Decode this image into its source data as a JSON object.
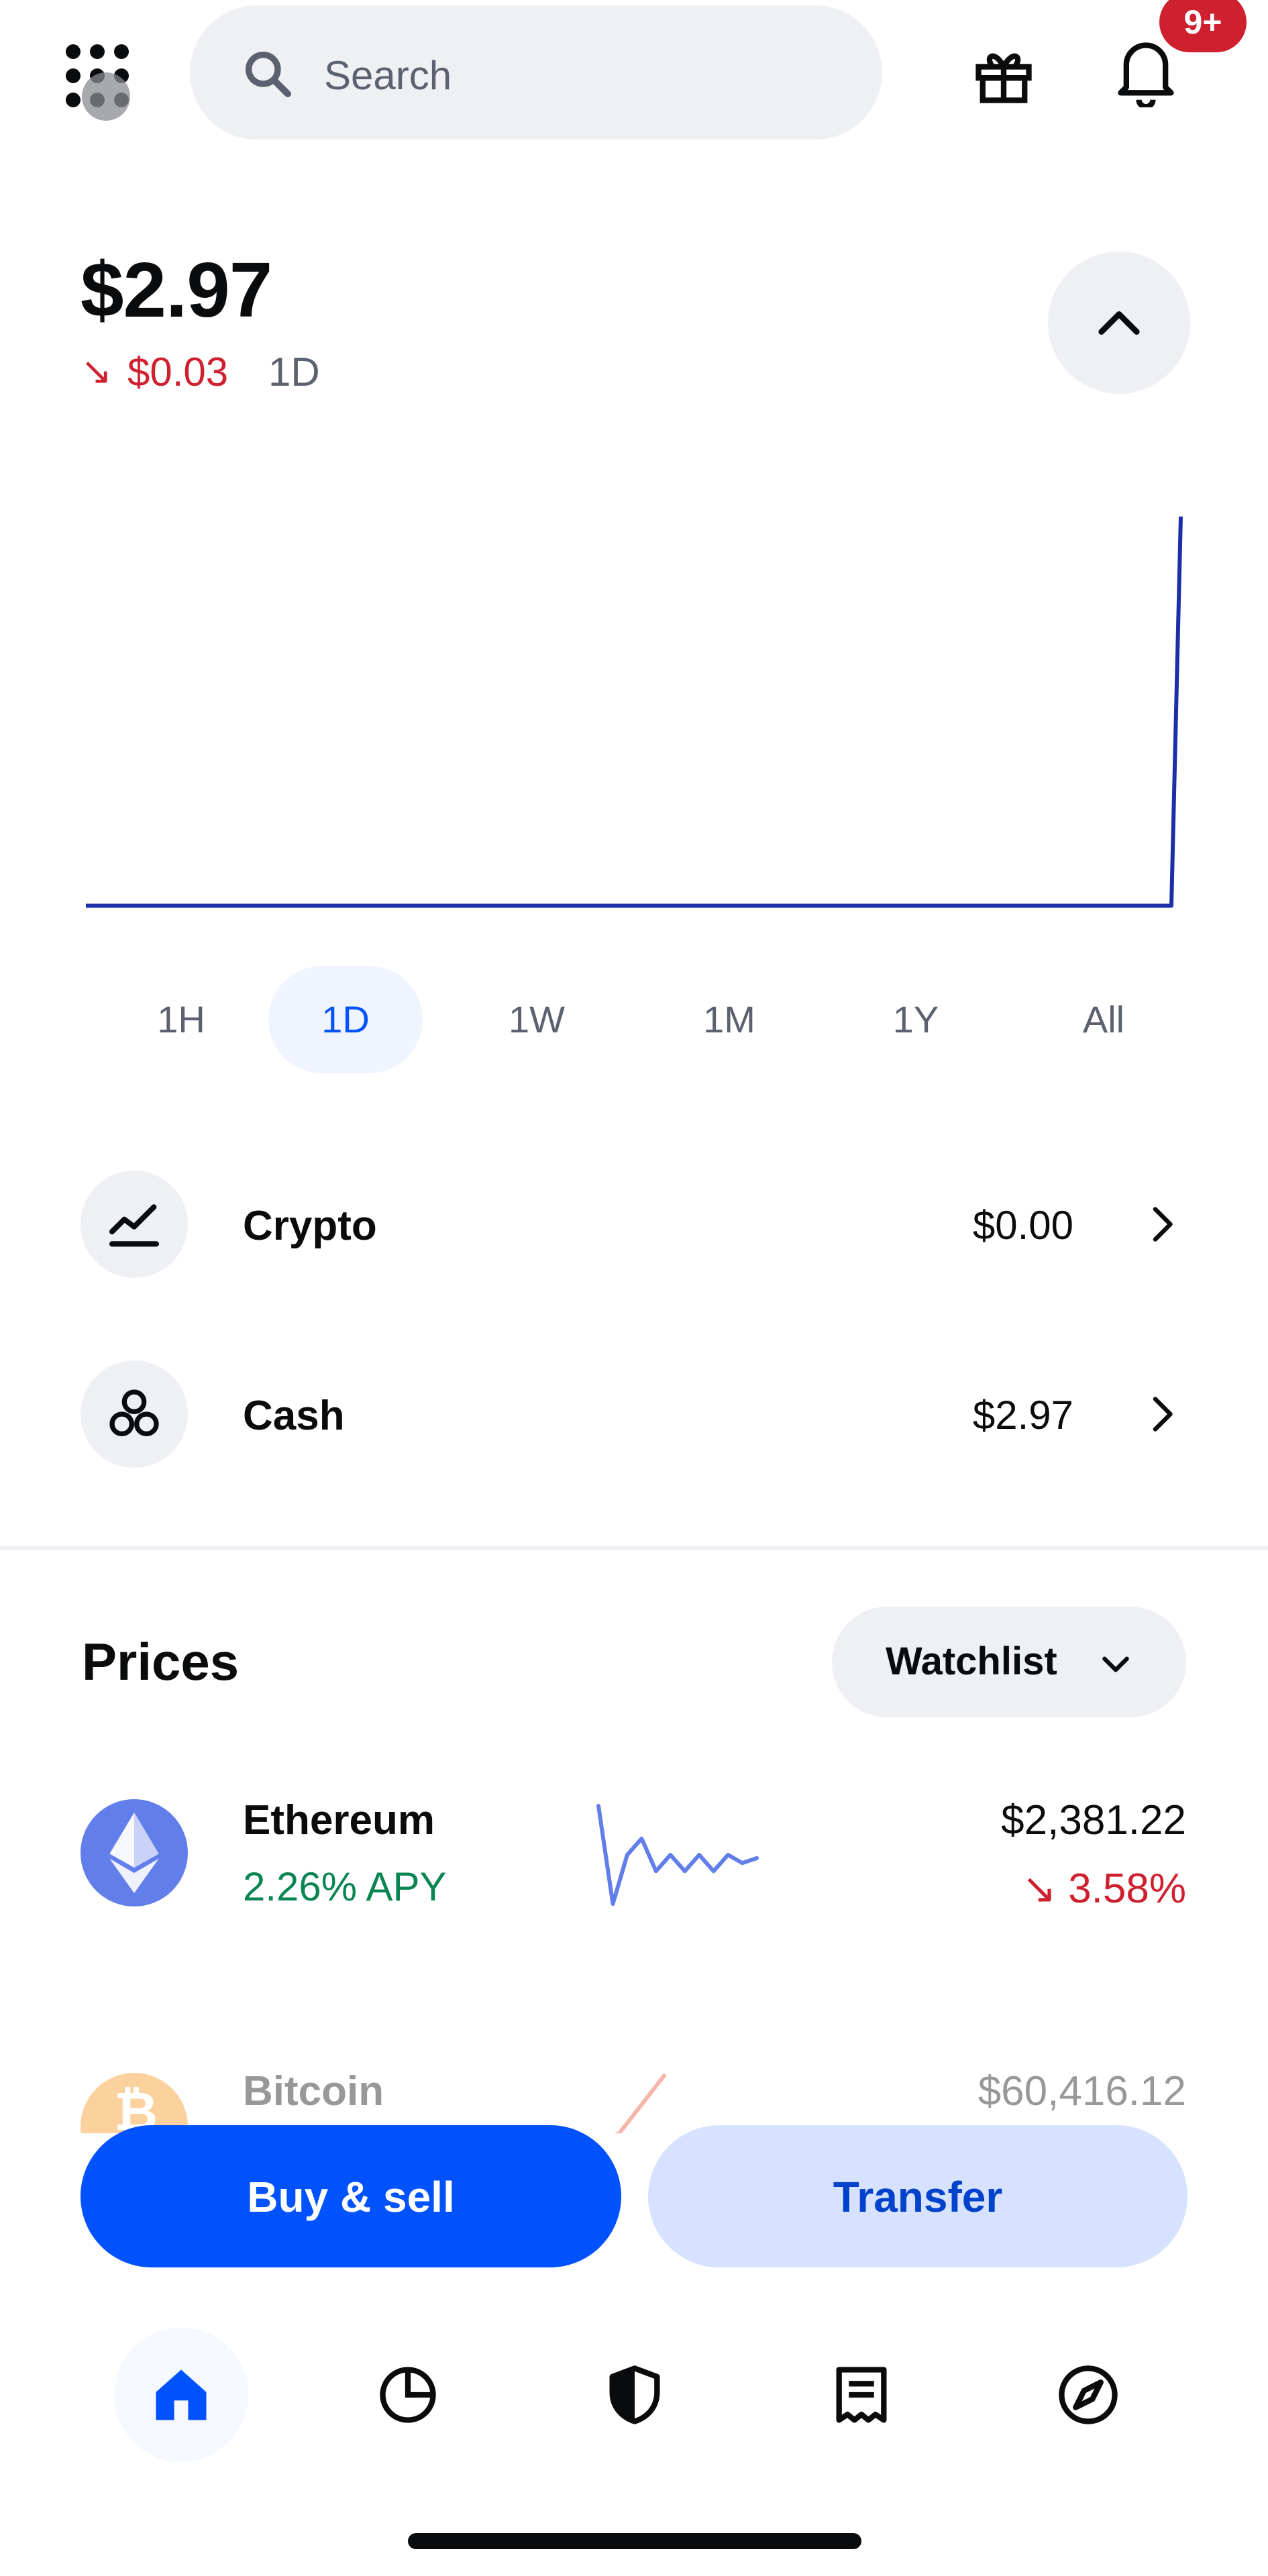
{
  "header": {
    "search_placeholder": "Search",
    "notification_badge": "9+",
    "icons": [
      "apps-grid-icon",
      "search-icon",
      "gift-icon",
      "bell-icon"
    ]
  },
  "balance": {
    "amount": "$2.97",
    "change_arrow": "↘",
    "change_value": "$0.03",
    "change_period": "1D"
  },
  "chart_data": {
    "type": "line",
    "title": "",
    "xlabel": "",
    "ylabel": "",
    "series": [
      {
        "values": [
          0,
          0,
          0,
          0,
          0,
          0,
          0,
          0,
          0,
          0,
          0,
          0,
          0,
          0,
          0,
          0,
          0,
          0,
          0,
          0,
          2.97
        ]
      }
    ],
    "color": "#1a2fa8",
    "grid": false
  },
  "range_tabs": [
    {
      "label": "1H",
      "active": false
    },
    {
      "label": "1D",
      "active": true
    },
    {
      "label": "1W",
      "active": false
    },
    {
      "label": "1M",
      "active": false
    },
    {
      "label": "1Y",
      "active": false
    },
    {
      "label": "All",
      "active": false
    }
  ],
  "assets": [
    {
      "name": "Crypto",
      "value": "$0.00",
      "icon": "chart-trend-icon"
    },
    {
      "name": "Cash",
      "value": "$2.97",
      "icon": "coins-icon"
    }
  ],
  "prices": {
    "title": "Prices",
    "filter_label": "Watchlist",
    "items": [
      {
        "name": "Ethereum",
        "subtitle": "2.26% APY",
        "price": "$2,381.22",
        "change_arrow": "↘",
        "change": "3.58%",
        "color": "#627eea",
        "sparkline": [
          9,
          3,
          6,
          7,
          5,
          6,
          5,
          6,
          5,
          6,
          5.5,
          5.8
        ]
      },
      {
        "name": "Bitcoin",
        "price": "$60,416.12",
        "color": "#f7931a",
        "sparkline": [
          2,
          3,
          6,
          9
        ]
      }
    ]
  },
  "actions": {
    "buy_sell": "Buy & sell",
    "transfer": "Transfer"
  },
  "bottom_nav": [
    {
      "icon": "home-icon",
      "active": true
    },
    {
      "icon": "portfolio-pie-icon",
      "active": false
    },
    {
      "icon": "shield-icon",
      "active": false
    },
    {
      "icon": "news-icon",
      "active": false
    },
    {
      "icon": "explore-compass-icon",
      "active": false
    }
  ]
}
